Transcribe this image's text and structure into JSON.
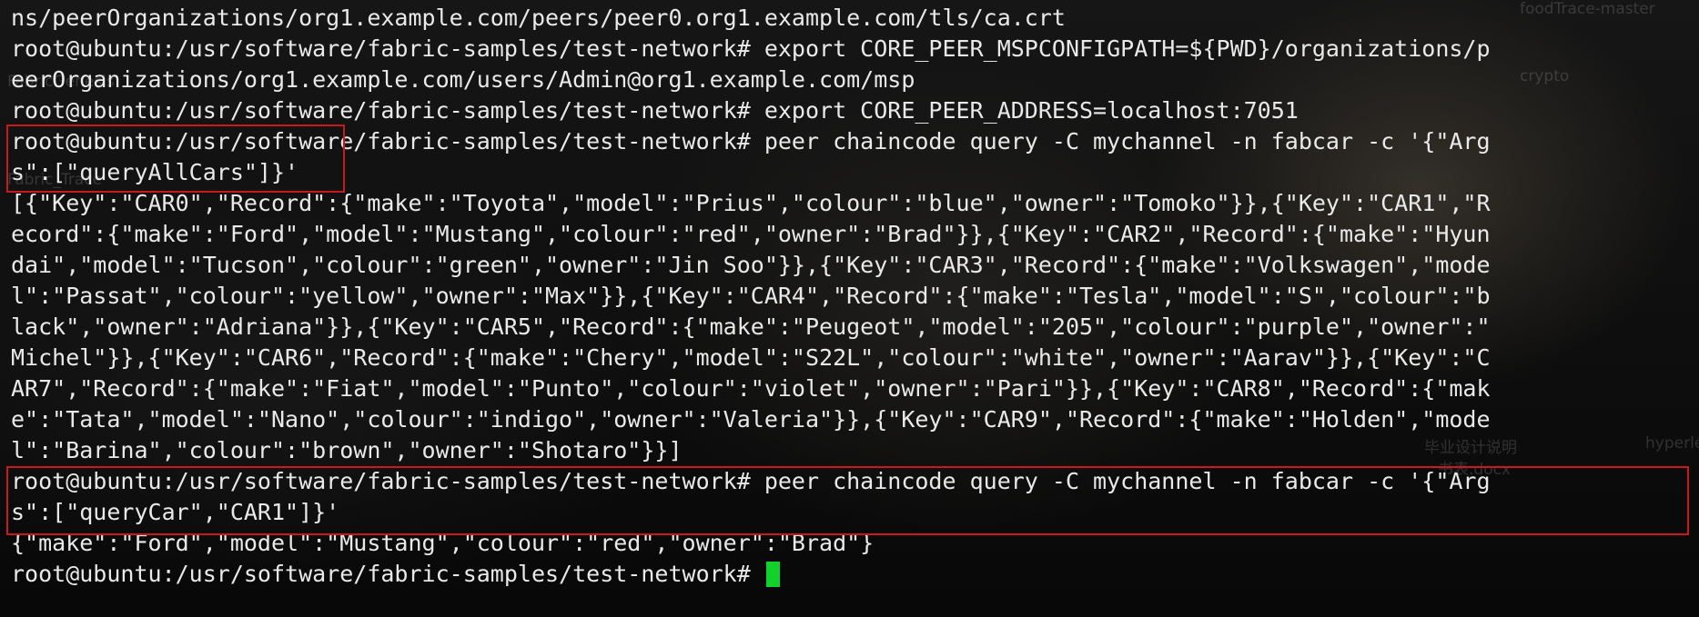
{
  "background_labels": [
    "FabricGenesis",
    "Fabric_Trace",
    "foodTrace-master",
    "crypto",
    "毕业设计说明",
    "书表.docx",
    "hyperle"
  ],
  "terminal": {
    "lines": [
      "ns/peerOrganizations/org1.example.com/peers/peer0.org1.example.com/tls/ca.crt",
      "root@ubuntu:/usr/software/fabric-samples/test-network# export CORE_PEER_MSPCONFIGPATH=${PWD}/organizations/p",
      "eerOrganizations/org1.example.com/users/Admin@org1.example.com/msp",
      "root@ubuntu:/usr/software/fabric-samples/test-network# export CORE_PEER_ADDRESS=localhost:7051",
      "root@ubuntu:/usr/software/fabric-samples/test-network# peer chaincode query -C mychannel -n fabcar -c '{\"Arg",
      "s\":[\"queryAllCars\"]}'",
      "[{\"Key\":\"CAR0\",\"Record\":{\"make\":\"Toyota\",\"model\":\"Prius\",\"colour\":\"blue\",\"owner\":\"Tomoko\"}},{\"Key\":\"CAR1\",\"R",
      "ecord\":{\"make\":\"Ford\",\"model\":\"Mustang\",\"colour\":\"red\",\"owner\":\"Brad\"}},{\"Key\":\"CAR2\",\"Record\":{\"make\":\"Hyun",
      "dai\",\"model\":\"Tucson\",\"colour\":\"green\",\"owner\":\"Jin Soo\"}},{\"Key\":\"CAR3\",\"Record\":{\"make\":\"Volkswagen\",\"mode",
      "l\":\"Passat\",\"colour\":\"yellow\",\"owner\":\"Max\"}},{\"Key\":\"CAR4\",\"Record\":{\"make\":\"Tesla\",\"model\":\"S\",\"colour\":\"b",
      "lack\",\"owner\":\"Adriana\"}},{\"Key\":\"CAR5\",\"Record\":{\"make\":\"Peugeot\",\"model\":\"205\",\"colour\":\"purple\",\"owner\":\"",
      "Michel\"}},{\"Key\":\"CAR6\",\"Record\":{\"make\":\"Chery\",\"model\":\"S22L\",\"colour\":\"white\",\"owner\":\"Aarav\"}},{\"Key\":\"C",
      "AR7\",\"Record\":{\"make\":\"Fiat\",\"model\":\"Punto\",\"colour\":\"violet\",\"owner\":\"Pari\"}},{\"Key\":\"CAR8\",\"Record\":{\"mak",
      "e\":\"Tata\",\"model\":\"Nano\",\"colour\":\"indigo\",\"owner\":\"Valeria\"}},{\"Key\":\"CAR9\",\"Record\":{\"make\":\"Holden\",\"mode",
      "l\":\"Barina\",\"colour\":\"brown\",\"owner\":\"Shotaro\"}}]",
      "root@ubuntu:/usr/software/fabric-samples/test-network# peer chaincode query -C mychannel -n fabcar -c '{\"Arg",
      "s\":[\"queryCar\",\"CAR1\"]}'",
      "{\"make\":\"Ford\",\"model\":\"Mustang\",\"colour\":\"red\",\"owner\":\"Brad\"}",
      "root@ubuntu:/usr/software/fabric-samples/test-network# "
    ],
    "text_color": "#e9e9e9",
    "cursor_color": "#10d22a",
    "highlight_color": "#c8191e"
  }
}
